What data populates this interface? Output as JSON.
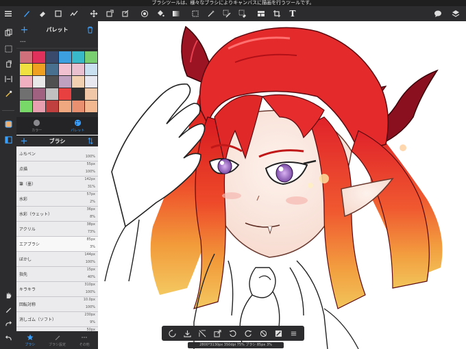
{
  "status_bar": {
    "text": "ブラシツールは、様々なブラシによりキャンバスに描画を行うツールです。"
  },
  "toolbar": {
    "menu_icon": "hamburger-icon",
    "tools": [
      "brush-icon",
      "eraser-icon",
      "rectangle-icon",
      "smudge-icon",
      "move-icon",
      "transform-icon",
      "crop-icon",
      "fill-icon",
      "bucket-icon",
      "gradient-icon",
      "selection-icon",
      "magic-wand-icon",
      "selection-pen-icon",
      "selection-eraser-icon",
      "layout-icon",
      "crop-select-icon"
    ],
    "text_tool_label": "T",
    "right_icons": [
      "chat-icon",
      "layers-icon"
    ]
  },
  "left_strip": {
    "icons": [
      "copy-layer-icon",
      "select-rect-icon",
      "flip-icon",
      "snap-icon",
      "eyedropper-icon",
      "color-icon",
      "panel-icon",
      "hand-icon",
      "pencil-icon",
      "redo-icon",
      "undo-icon"
    ]
  },
  "palette": {
    "title": "パレット",
    "name": "---",
    "swatches": [
      "#d0707a",
      "#e0305c",
      "#3a4a6c",
      "#3ca0e0",
      "#38b8c8",
      "#7ad070",
      "#f0e040",
      "#f0a020",
      "#4a7090",
      "#f0c0d0",
      "#e8c0d0",
      "#c8e0f0",
      "#f0b0c0",
      "#e8e8e8",
      "#505050",
      "#c0a0c0",
      "#f0d0b0",
      "#e8e8f0",
      "#707070",
      "#a06080",
      "#c0c0c0",
      "#e84040",
      "#303030",
      "#f0c8a8",
      "#78d868",
      "#e8a0b0",
      "#c04040",
      "#f0a880",
      "#e89070",
      "#f4b890"
    ],
    "tabs": [
      {
        "label": "カラー",
        "icon": "color-circle-icon"
      },
      {
        "label": "パレット",
        "icon": "palette-icon"
      }
    ]
  },
  "brush_panel": {
    "title": "ブラシ",
    "items": [
      {
        "name": "ふちペン",
        "size": "",
        "opacity": "100%"
      },
      {
        "name": "点描",
        "size": "55px",
        "opacity": "100%"
      },
      {
        "name": "筆（墨）",
        "size": "142px",
        "opacity": "31%"
      },
      {
        "name": "水彩",
        "size": "57px",
        "opacity": "2%"
      },
      {
        "name": "水彩（ウェット）",
        "size": "36px",
        "opacity": "8%"
      },
      {
        "name": "アクリル",
        "size": "38px",
        "opacity": "73%"
      },
      {
        "name": "エアブラシ",
        "size": "85px",
        "opacity": "3%",
        "selected": true
      },
      {
        "name": "ぼかし",
        "size": "144px",
        "opacity": "100%"
      },
      {
        "name": "指先",
        "size": "15px",
        "opacity": "40%"
      },
      {
        "name": "キラキラ",
        "size": "310px",
        "opacity": "100%"
      },
      {
        "name": "回転対称",
        "size": "10.0px",
        "opacity": "100%"
      },
      {
        "name": "消しゴム（ソフト）",
        "size": "230px",
        "opacity": "9%"
      },
      {
        "name": "消しゴム",
        "size": "50px",
        "opacity": ""
      }
    ],
    "tabs": [
      {
        "label": "ブラシ",
        "icon": "star-icon",
        "active": true
      },
      {
        "label": "ブラシ設定",
        "icon": "brush-settings-icon"
      },
      {
        "label": "その他",
        "icon": "more-icon"
      }
    ]
  },
  "bottom_bar": {
    "icons": [
      "rotate-icon",
      "import-icon",
      "grid-off-icon",
      "export-icon",
      "rotate-left-icon",
      "rotate-right-icon",
      "flip-off-icon",
      "snap-toggle-icon",
      "menu-icon"
    ],
    "info": "2800*3130px 350dpi 75% ブラシ 85px 3%"
  },
  "colors": {
    "accent": "#3aa0ff",
    "panel_bg": "#2c2c2e",
    "hair_red": "#e02a2a",
    "hair_orange": "#f08a30",
    "hair_yellow": "#f2c04a",
    "horn": "#8a1020",
    "eye": "#8a5ab8"
  }
}
